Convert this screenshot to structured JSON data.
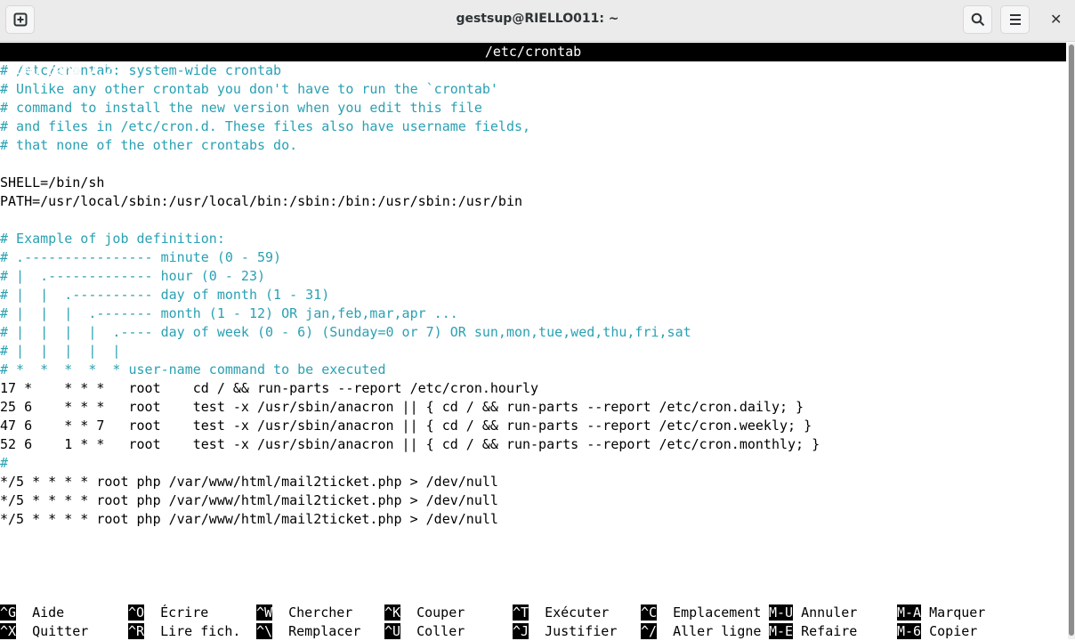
{
  "window": {
    "title": "gestsup@RIELLO011: ~",
    "new_tab_icon": "plus-square-icon",
    "search_icon": "search-icon",
    "menu_icon": "hamburger-icon",
    "close_icon": "close-icon"
  },
  "nano": {
    "version": "GNU nano 7.2",
    "filename": "/etc/crontab"
  },
  "lines": [
    {
      "t": "# /etc/crontab: system-wide crontab",
      "c": true
    },
    {
      "t": "# Unlike any other crontab you don't have to run the `crontab'",
      "c": true
    },
    {
      "t": "# command to install the new version when you edit this file",
      "c": true
    },
    {
      "t": "# and files in /etc/cron.d. These files also have username fields,",
      "c": true
    },
    {
      "t": "# that none of the other crontabs do.",
      "c": true
    },
    {
      "t": "",
      "c": false
    },
    {
      "t": "SHELL=/bin/sh",
      "c": false
    },
    {
      "t": "PATH=/usr/local/sbin:/usr/local/bin:/sbin:/bin:/usr/sbin:/usr/bin",
      "c": false
    },
    {
      "t": "",
      "c": false
    },
    {
      "t": "# Example of job definition:",
      "c": true
    },
    {
      "t": "# .---------------- minute (0 - 59)",
      "c": true
    },
    {
      "t": "# |  .------------- hour (0 - 23)",
      "c": true
    },
    {
      "t": "# |  |  .---------- day of month (1 - 31)",
      "c": true
    },
    {
      "t": "# |  |  |  .------- month (1 - 12) OR jan,feb,mar,apr ...",
      "c": true
    },
    {
      "t": "# |  |  |  |  .---- day of week (0 - 6) (Sunday=0 or 7) OR sun,mon,tue,wed,thu,fri,sat",
      "c": true
    },
    {
      "t": "# |  |  |  |  |",
      "c": true
    },
    {
      "t": "# *  *  *  *  * user-name command to be executed",
      "c": true
    },
    {
      "t": "17 *    * * *   root    cd / && run-parts --report /etc/cron.hourly",
      "c": false
    },
    {
      "t": "25 6    * * *   root    test -x /usr/sbin/anacron || { cd / && run-parts --report /etc/cron.daily; }",
      "c": false
    },
    {
      "t": "47 6    * * 7   root    test -x /usr/sbin/anacron || { cd / && run-parts --report /etc/cron.weekly; }",
      "c": false
    },
    {
      "t": "52 6    1 * *   root    test -x /usr/sbin/anacron || { cd / && run-parts --report /etc/cron.monthly; }",
      "c": false
    },
    {
      "t": "#",
      "c": true
    },
    {
      "t": "*/5 * * * * root php /var/www/html/mail2ticket.php > /dev/null",
      "c": false
    },
    {
      "t": "*/5 * * * * root php /var/www/html/mail2ticket.php > /dev/null",
      "c": false
    },
    {
      "t": "*/5 * * * * root php /var/www/html/mail2ticket.php > /dev/null",
      "c": false
    }
  ],
  "shortcuts": [
    [
      {
        "k": "^G",
        "l": "Aide"
      },
      {
        "k": "^O",
        "l": "Écrire"
      },
      {
        "k": "^W",
        "l": "Chercher"
      },
      {
        "k": "^K",
        "l": "Couper"
      },
      {
        "k": "^T",
        "l": "Exécuter"
      },
      {
        "k": "^C",
        "l": "Emplacement"
      },
      {
        "k": "M-U",
        "l": "Annuler"
      },
      {
        "k": "M-A",
        "l": "Marquer"
      }
    ],
    [
      {
        "k": "^X",
        "l": "Quitter"
      },
      {
        "k": "^R",
        "l": "Lire fich."
      },
      {
        "k": "^\\",
        "l": "Remplacer"
      },
      {
        "k": "^U",
        "l": "Coller"
      },
      {
        "k": "^J",
        "l": "Justifier"
      },
      {
        "k": "^/",
        "l": "Aller ligne"
      },
      {
        "k": "M-E",
        "l": "Refaire"
      },
      {
        "k": "M-6",
        "l": "Copier"
      }
    ]
  ]
}
